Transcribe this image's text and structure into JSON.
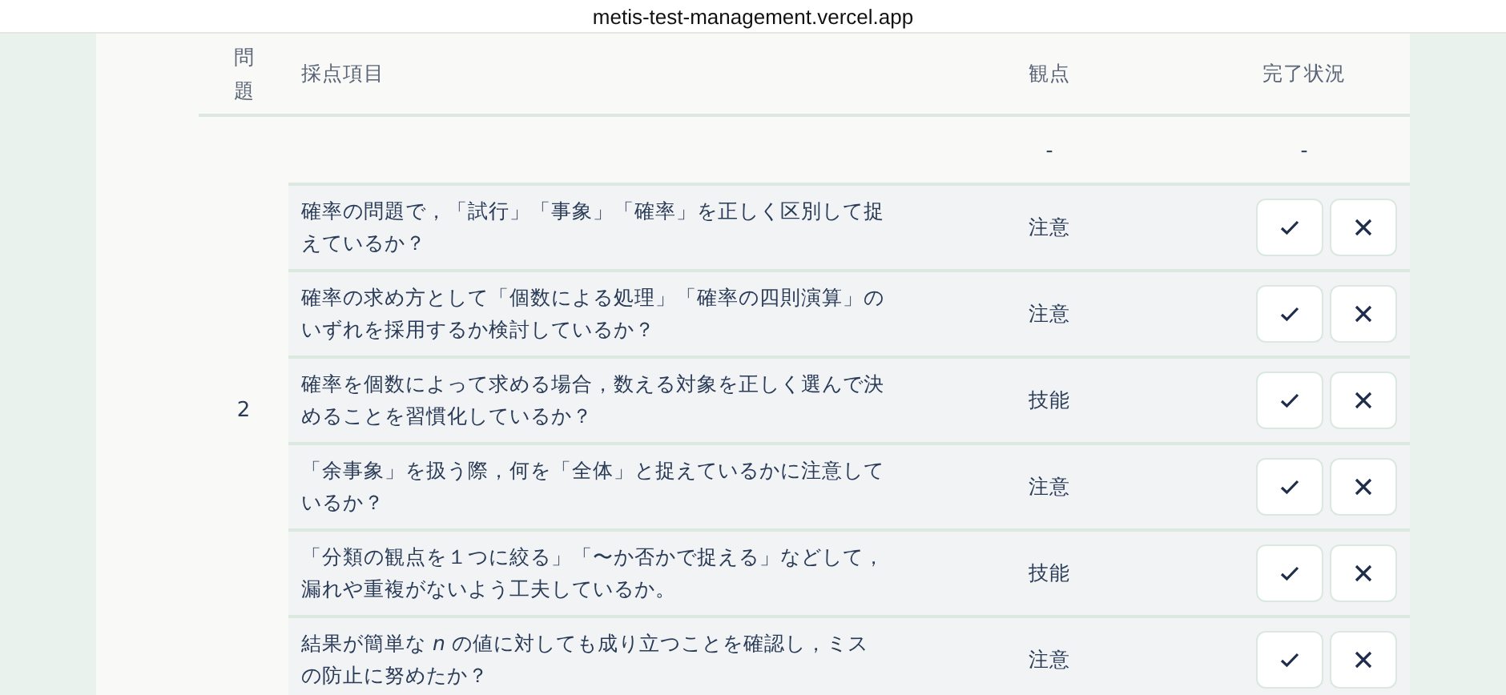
{
  "browser": {
    "url": "metis-test-management.vercel.app"
  },
  "table": {
    "columns": [
      "問題",
      "採点項目",
      "観点",
      "完了状況"
    ],
    "groups": [
      {
        "problem": "2",
        "rows": [
          {
            "kind": "summary",
            "item": "",
            "viewpoint": "-",
            "status": "-"
          },
          {
            "kind": "item",
            "item": "確率の問題で，「試行」「事象」「確率」を正しく区別して捉えているか？",
            "viewpoint": "注意"
          },
          {
            "kind": "item",
            "item": "確率の求め方として「個数による処理」「確率の四則演算」のいずれを採用するか検討しているか？",
            "viewpoint": "注意"
          },
          {
            "kind": "item",
            "item": "確率を個数によって求める場合，数える対象を正しく選んで決めることを習慣化しているか？",
            "viewpoint": "技能"
          },
          {
            "kind": "item",
            "item": "「余事象」を扱う際，何を「全体」と捉えているかに注意しているか？",
            "viewpoint": "注意"
          },
          {
            "kind": "item",
            "item": "「分類の観点を１つに絞る」「〜か否かで捉える」などして，漏れや重複がないよう工夫しているか。",
            "viewpoint": "技能"
          },
          {
            "kind": "item",
            "item": "結果が簡単な *n* の値に対しても成り立つことを確認し，ミスの防止に努めたか？",
            "viewpoint": "注意"
          }
        ]
      }
    ]
  }
}
